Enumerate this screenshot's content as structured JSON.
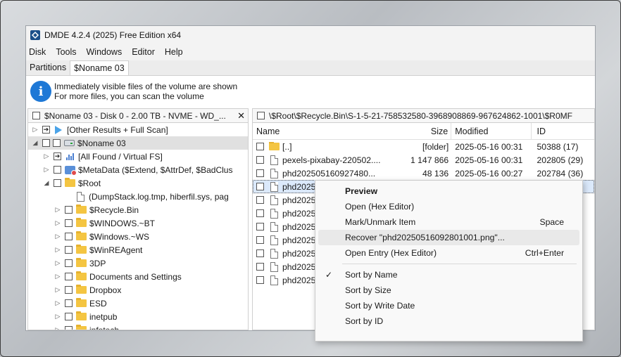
{
  "window": {
    "title": "DMDE 4.2.4 (2025) Free Edition x64"
  },
  "menu": [
    "Disk",
    "Tools",
    "Windows",
    "Editor",
    "Help"
  ],
  "tabs": [
    "Partitions",
    "$Noname 03"
  ],
  "info": {
    "line1": "Immediately visible files of the volume are shown",
    "line2": "For more files, you can scan the volume"
  },
  "left_panel": {
    "header": "$Noname 03 - Disk 0 - 2.00 TB - NVME - WD_...",
    "close": "✕",
    "tree": [
      {
        "label": "[Other Results + Full Scan]"
      },
      {
        "label": "$Noname 03"
      },
      {
        "label": "[All Found / Virtual FS]"
      },
      {
        "label": "$MetaData ($Extend, $AttrDef, $BadClus"
      },
      {
        "label": "$Root"
      },
      {
        "label": "(DumpStack.log.tmp, hiberfil.sys, pag"
      },
      {
        "label": "$Recycle.Bin"
      },
      {
        "label": "$WINDOWS.~BT"
      },
      {
        "label": "$Windows.~WS"
      },
      {
        "label": "$WinREAgent"
      },
      {
        "label": "3DP"
      },
      {
        "label": "Documents and Settings"
      },
      {
        "label": "Dropbox"
      },
      {
        "label": "ESD"
      },
      {
        "label": "inetpub"
      },
      {
        "label": "infotech"
      }
    ]
  },
  "right_panel": {
    "path": "\\$Root\\$Recycle.Bin\\S-1-5-21-758532580-3968908869-967624862-1001\\$R0MF",
    "columns": {
      "name": "Name",
      "size": "Size",
      "modified": "Modified",
      "id": "ID"
    },
    "rows": [
      {
        "name": "[..]",
        "size": "[folder]",
        "modified": "2025-05-16 00:31",
        "id": "50388 (17)"
      },
      {
        "name": "pexels-pixabay-220502....",
        "size": "1 147 866",
        "modified": "2025-05-16 00:31",
        "id": "202805 (29)"
      },
      {
        "name": "phd202505160927480...",
        "size": "48 136",
        "modified": "2025-05-16 00:27",
        "id": "202784 (36)"
      },
      {
        "name": "phd2025",
        "size": "",
        "modified": "",
        "id": ")"
      },
      {
        "name": "phd2025",
        "size": "",
        "modified": "",
        "id": ""
      },
      {
        "name": "phd2025",
        "size": "",
        "modified": "",
        "id": ")"
      },
      {
        "name": "phd2025",
        "size": "",
        "modified": "",
        "id": ")"
      },
      {
        "name": "phd2025",
        "size": "",
        "modified": "",
        "id": ")"
      },
      {
        "name": "phd2025",
        "size": "",
        "modified": "",
        "id": ")"
      },
      {
        "name": "phd2025",
        "size": "",
        "modified": "",
        "id": ")"
      },
      {
        "name": "phd2025",
        "size": "",
        "modified": "",
        "id": ")"
      }
    ]
  },
  "context_menu": {
    "items": [
      {
        "label": "Preview",
        "shortcut": ""
      },
      {
        "label": "Open (Hex Editor)",
        "shortcut": ""
      },
      {
        "label": "Mark/Unmark Item",
        "shortcut": "Space"
      },
      {
        "label": "Recover \"phd20250516092801001.png\"...",
        "shortcut": ""
      },
      {
        "label": "Open Entry (Hex Editor)",
        "shortcut": "Ctrl+Enter"
      },
      {
        "label": "Sort by Name",
        "shortcut": "",
        "check": "✓"
      },
      {
        "label": "Sort by Size",
        "shortcut": ""
      },
      {
        "label": "Sort by Write Date",
        "shortcut": ""
      },
      {
        "label": "Sort by ID",
        "shortcut": ""
      }
    ]
  },
  "colors": {
    "accent": "#1e78d6",
    "folder": "#f4c542",
    "selection": "#dbe9fb"
  }
}
